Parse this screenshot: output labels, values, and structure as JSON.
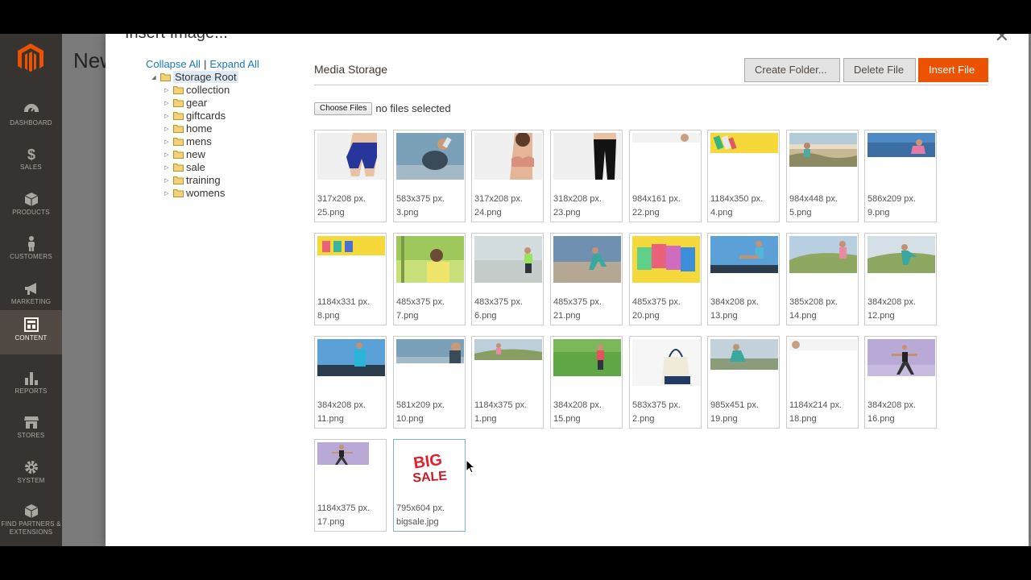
{
  "admin_menu": {
    "items": [
      {
        "label": "DASHBOARD",
        "icon": "dashboard-icon"
      },
      {
        "label": "SALES",
        "icon": "dollar-icon"
      },
      {
        "label": "PRODUCTS",
        "icon": "box-icon"
      },
      {
        "label": "CUSTOMERS",
        "icon": "person-icon"
      },
      {
        "label": "MARKETING",
        "icon": "megaphone-icon"
      },
      {
        "label": "CONTENT",
        "icon": "layout-icon",
        "active": true
      },
      {
        "label": "REPORTS",
        "icon": "bar-chart-icon"
      },
      {
        "label": "STORES",
        "icon": "store-icon"
      },
      {
        "label": "SYSTEM",
        "icon": "gear-icon"
      },
      {
        "label": "FIND PARTNERS & EXTENSIONS",
        "icon": "cube-icon"
      }
    ]
  },
  "background_page": {
    "title": "New"
  },
  "modal": {
    "title": "Insert Image...",
    "close_glyph": "✕"
  },
  "tree": {
    "collapse_all": "Collapse All",
    "separator": "|",
    "expand_all": "Expand All",
    "root": "Storage Root",
    "folders": [
      "collection",
      "gear",
      "giftcards",
      "home",
      "mens",
      "new",
      "sale",
      "training",
      "womens"
    ]
  },
  "media": {
    "title": "Media Storage",
    "create_folder": "Create Folder...",
    "delete_file": "Delete File",
    "insert_file": "Insert File",
    "choose_files": "Choose Files",
    "no_files": "no files selected"
  },
  "files": [
    {
      "dims": "317x208 px.",
      "name": "25.png",
      "img": "shorts"
    },
    {
      "dims": "583x375 px.",
      "name": "3.png",
      "img": "drink"
    },
    {
      "dims": "317x208 px.",
      "name": "24.png",
      "img": "bra"
    },
    {
      "dims": "318x208 px.",
      "name": "23.png",
      "img": "pants"
    },
    {
      "dims": "984x161 px.",
      "name": "22.png",
      "img": "thin"
    },
    {
      "dims": "1184x350 px.",
      "name": "4.png",
      "img": "yellowbanner"
    },
    {
      "dims": "984x448 px.",
      "name": "5.png",
      "img": "beach"
    },
    {
      "dims": "586x209 px.",
      "name": "9.png",
      "img": "sea"
    },
    {
      "dims": "1184x331 px.",
      "name": "8.png",
      "img": "yellowshirts"
    },
    {
      "dims": "485x375 px.",
      "name": "7.png",
      "img": "green"
    },
    {
      "dims": "483x375 px.",
      "name": "6.png",
      "img": "runner"
    },
    {
      "dims": "485x375 px.",
      "name": "21.png",
      "img": "stretch"
    },
    {
      "dims": "485x375 px.",
      "name": "20.png",
      "img": "tanks"
    },
    {
      "dims": "384x208 px.",
      "name": "13.png",
      "img": "skyman"
    },
    {
      "dims": "385x208 px.",
      "name": "14.png",
      "img": "dune"
    },
    {
      "dims": "384x208 px.",
      "name": "12.png",
      "img": "dune2"
    },
    {
      "dims": "384x208 px.",
      "name": "11.png",
      "img": "skywoman"
    },
    {
      "dims": "581x209 px.",
      "name": "10.png",
      "img": "drinkwide"
    },
    {
      "dims": "1184x375 px.",
      "name": "1.png",
      "img": "dunewide"
    },
    {
      "dims": "384x208 px.",
      "name": "15.png",
      "img": "greenrun"
    },
    {
      "dims": "583x375 px.",
      "name": "2.png",
      "img": "bag"
    },
    {
      "dims": "985x451 px.",
      "name": "19.png",
      "img": "sitting"
    },
    {
      "dims": "1184x214 px.",
      "name": "18.png",
      "img": "thin2"
    },
    {
      "dims": "384x208 px.",
      "name": "16.png",
      "img": "yoga"
    },
    {
      "dims": "1184x375 px.",
      "name": "17.png",
      "img": "yogawide"
    },
    {
      "dims": "795x604 px.",
      "name": "bigsale.jpg",
      "img": "bigsale",
      "selected": true
    }
  ]
}
